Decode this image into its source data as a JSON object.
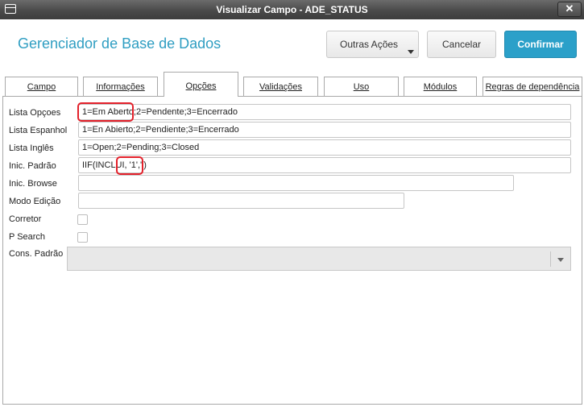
{
  "window": {
    "title": "Visualizar Campo - ADE_STATUS",
    "close_glyph": "✕"
  },
  "header": {
    "title": "Gerenciador de Base de Dados",
    "outras_acoes": "Outras Ações",
    "cancelar": "Cancelar",
    "confirmar": "Confirmar"
  },
  "colors": {
    "accent": "#2ba0c9",
    "title": "#2f9ec2",
    "highlight": "#e3202a"
  },
  "tabs": [
    {
      "label": "Campo"
    },
    {
      "label": "Informações"
    },
    {
      "label": "Opções",
      "active": true
    },
    {
      "label": "Validações"
    },
    {
      "label": "Uso"
    },
    {
      "label": "Módulos"
    },
    {
      "label": "Regras de dependência"
    }
  ],
  "form": {
    "lista_opcoes": {
      "label": "Lista Opçoes",
      "value": "1=Em Aberto;2=Pendente;3=Encerrado"
    },
    "lista_espanhol": {
      "label": "Lista Espanhol",
      "value": "1=En Abierto;2=Pendiente;3=Encerrado"
    },
    "lista_ingles": {
      "label": "Lista Inglês",
      "value": "1=Open;2=Pending;3=Closed"
    },
    "inic_padrao": {
      "label": "Inic. Padrão",
      "value": "IIF(INCLUI, '1','')"
    },
    "inic_browse": {
      "label": "Inic. Browse",
      "value": ""
    },
    "modo_edicao": {
      "label": "Modo Edição",
      "value": ""
    },
    "corretor": {
      "label": "Corretor",
      "checked": false
    },
    "p_search": {
      "label": "P Search",
      "checked": false
    },
    "cons_padrao": {
      "label": "Cons. Padrão",
      "value": ""
    }
  }
}
